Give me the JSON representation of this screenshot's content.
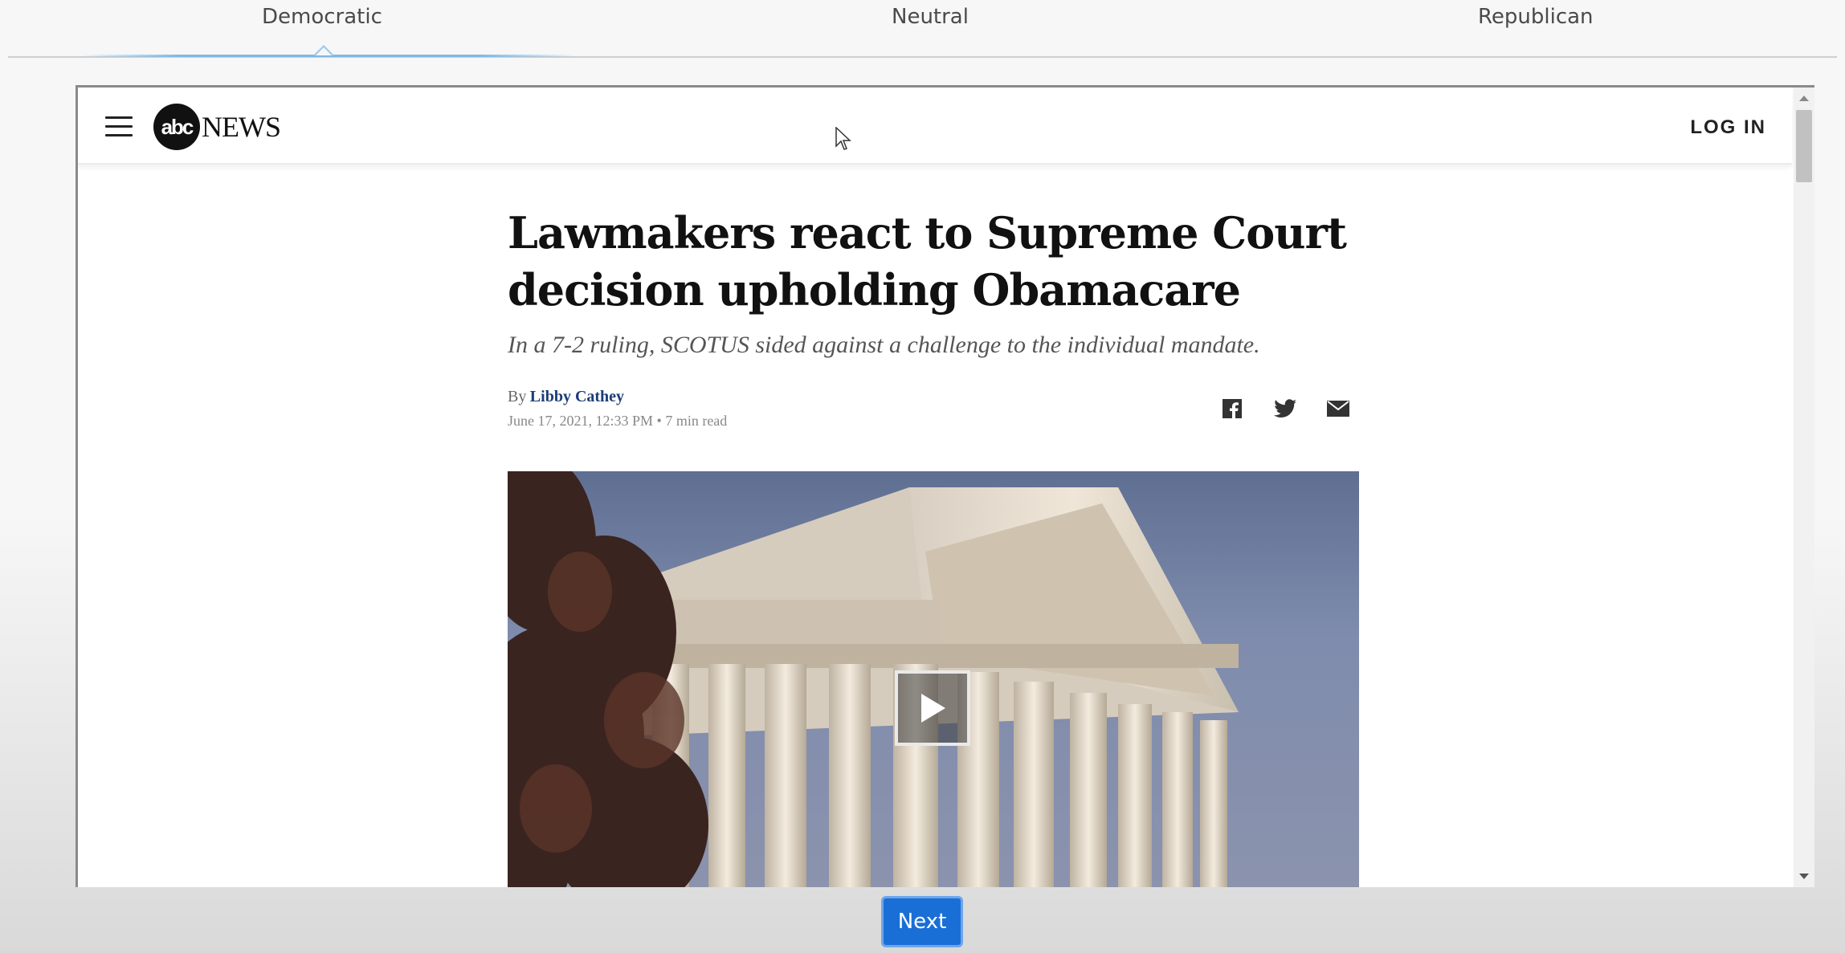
{
  "tabs": [
    {
      "label": "Democratic",
      "active": true
    },
    {
      "label": "Neutral",
      "active": false
    },
    {
      "label": "Republican",
      "active": false
    }
  ],
  "site": {
    "logo_circle": "abc",
    "logo_word": "NEWS",
    "login_label": "LOG IN"
  },
  "article": {
    "headline": "Lawmakers react to Supreme Court decision upholding Obamacare",
    "dek": "In a 7-2 ruling, SCOTUS sided against a challenge to the individual mandate.",
    "by_prefix": "By",
    "author": "Libby Cathey",
    "date": "June 17, 2021, 12:33 PM",
    "read_time": "• 7 min read",
    "share_icons": [
      "facebook-icon",
      "twitter-icon",
      "email-icon"
    ]
  },
  "next_button": {
    "label": "Next"
  },
  "colors": {
    "active_tab_underline": "#7fb8e6",
    "author_link": "#1d3c78",
    "next_button": "#1a6fd6"
  }
}
